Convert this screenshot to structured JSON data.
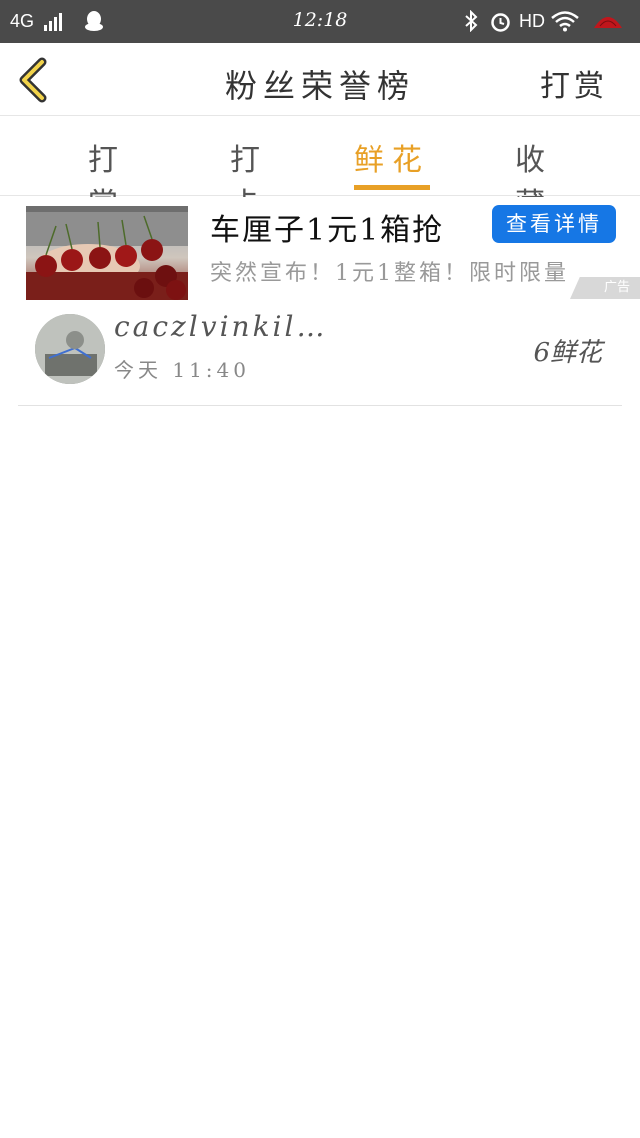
{
  "status_bar": {
    "network": "4G",
    "time": "12:18",
    "hd_label": "HD",
    "icons": [
      "signal-icon",
      "qq-icon",
      "bluetooth-icon",
      "alarm-icon",
      "wifi-icon",
      "fan-icon"
    ]
  },
  "header": {
    "back_icon": "chevron-left-icon",
    "title": "粉丝荣誉榜",
    "right_action": "打赏"
  },
  "tabs": [
    {
      "label": "打赏",
      "active": false
    },
    {
      "label": "打卡",
      "active": false
    },
    {
      "label": "鲜花",
      "active": true
    },
    {
      "label": "收藏",
      "active": false
    }
  ],
  "ad": {
    "title": "车厘子1元1箱抢",
    "button": "查看详情",
    "subtitle": "突然宣布！1元1整箱！限时限量",
    "tag": "广告"
  },
  "ranking": [
    {
      "username": "caczlvinkil…",
      "time": "今天 11:40",
      "amount": "6鲜花"
    }
  ],
  "colors": {
    "accent": "#e8a026",
    "ad_button": "#1677e5",
    "status_bar": "#4a4a4a"
  }
}
